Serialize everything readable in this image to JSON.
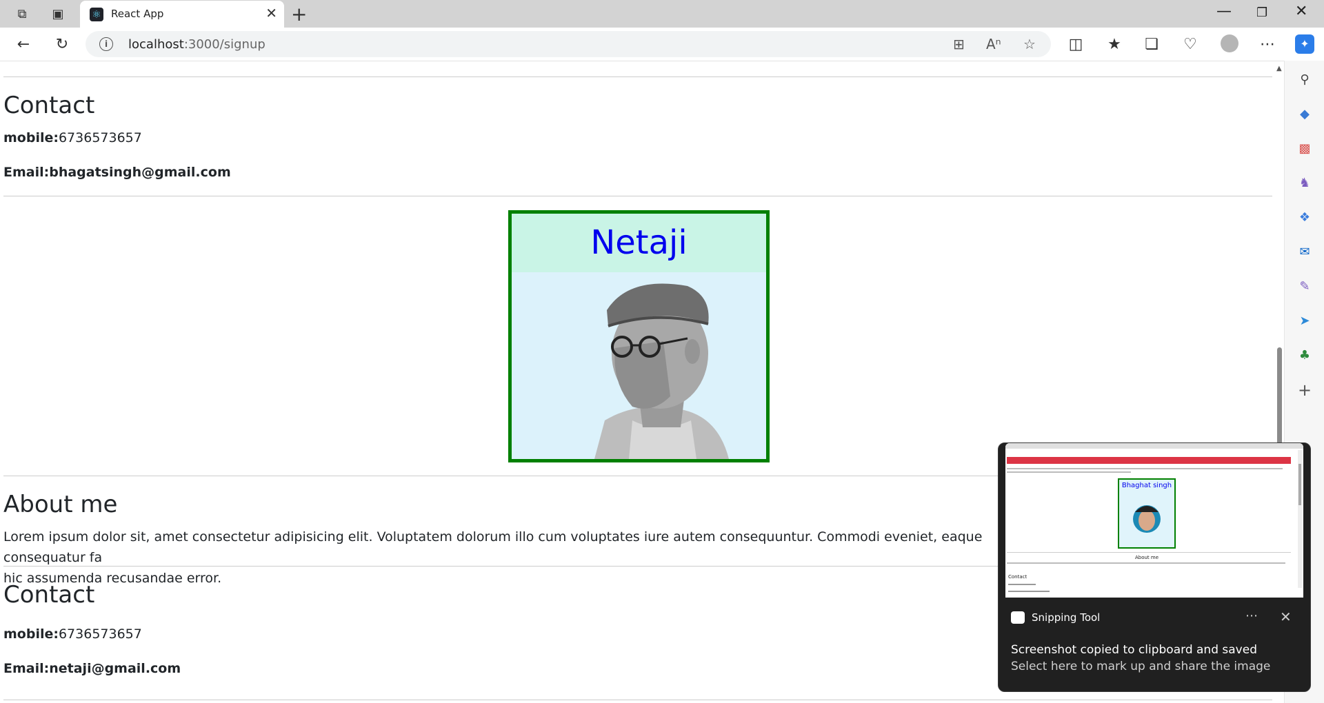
{
  "browser": {
    "tab_title": "React App",
    "url_host": "localhost",
    "url_path": ":3000/signup"
  },
  "page": {
    "contact1": {
      "heading": "Contact",
      "mobile_label": "mobile:",
      "mobile_value": "6736573657",
      "email_label": "Email:",
      "email_value": "bhagatsingh@gmail.com"
    },
    "card": {
      "title": "Netaji",
      "border_color": "#008000",
      "title_color": "#0000ee"
    },
    "about": {
      "heading": "About me",
      "text": "Lorem ipsum dolor sit, amet consectetur adipisicing elit. Voluptatem dolorum illo cum voluptates iure autem consequuntur. Commodi eveniet, eaque consequatur fa",
      "text2": "hic assumenda recusandae error."
    },
    "contact2": {
      "heading": "Contact",
      "mobile_label": "mobile:",
      "mobile_value": "6736573657",
      "email_label": "Email:",
      "email_value": "netaji@gmail.com"
    }
  },
  "toast": {
    "app_name": "Snipping Tool",
    "message": "Screenshot copied to clipboard and saved",
    "submessage": "Select here to mark up and share the image",
    "preview_card_title": "Bhaghat singh",
    "preview_about": "About me",
    "preview_contact": "Contact"
  }
}
